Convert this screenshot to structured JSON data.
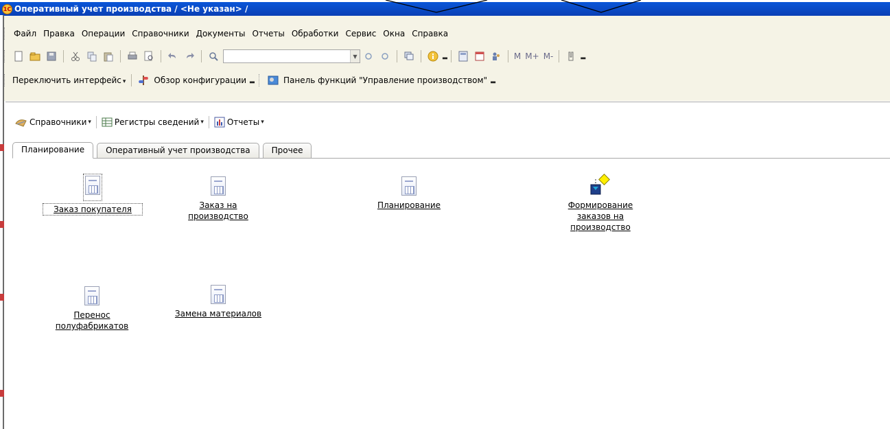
{
  "window": {
    "title": "Оперативный учет производства / <Не указан> /",
    "app_icon_text": "1С"
  },
  "menubar": {
    "items": [
      "Файл",
      "Правка",
      "Операции",
      "Справочники",
      "Документы",
      "Отчеты",
      "Обработки",
      "Сервис",
      "Окна",
      "Справка"
    ]
  },
  "toolbar1": {
    "search_value": "",
    "memory_buttons": [
      "M",
      "M+",
      "M-"
    ]
  },
  "toolbar2": {
    "switch_interface": "Переключить интерфейс",
    "config_overview": "Обзор конфигурации",
    "functions_panel": "Панель функций \"Управление производством\""
  },
  "actionbar": {
    "catalogs": "Справочники",
    "registers": "Регистры сведений",
    "reports": "Отчеты"
  },
  "tabs": [
    "Планирование",
    "Оперативный учет производства",
    "Прочее"
  ],
  "active_tab": "Планирование",
  "commands": [
    {
      "label_lines": [
        "Заказ покупателя"
      ],
      "icon": "document-icon",
      "focused": true
    },
    {
      "label_lines": [
        "Заказ на",
        "производство"
      ],
      "icon": "document-icon",
      "focused": false
    },
    {
      "label_lines": [
        "Планирование"
      ],
      "icon": "document-icon",
      "focused": false
    },
    {
      "label_lines": [
        "Формирование",
        "заказов на",
        "производство"
      ],
      "icon": "data-processor-icon",
      "focused": false
    },
    {
      "label_lines": [
        "Перенос",
        "полуфабрикатов"
      ],
      "icon": "document-icon",
      "focused": false
    },
    {
      "label_lines": [
        "Замена материалов"
      ],
      "icon": "document-icon",
      "focused": false
    }
  ],
  "colors": {
    "titlebar": "#0a4bc8",
    "chrome": "#f5f3e6",
    "left_edge_accent": "#c83c3c"
  }
}
